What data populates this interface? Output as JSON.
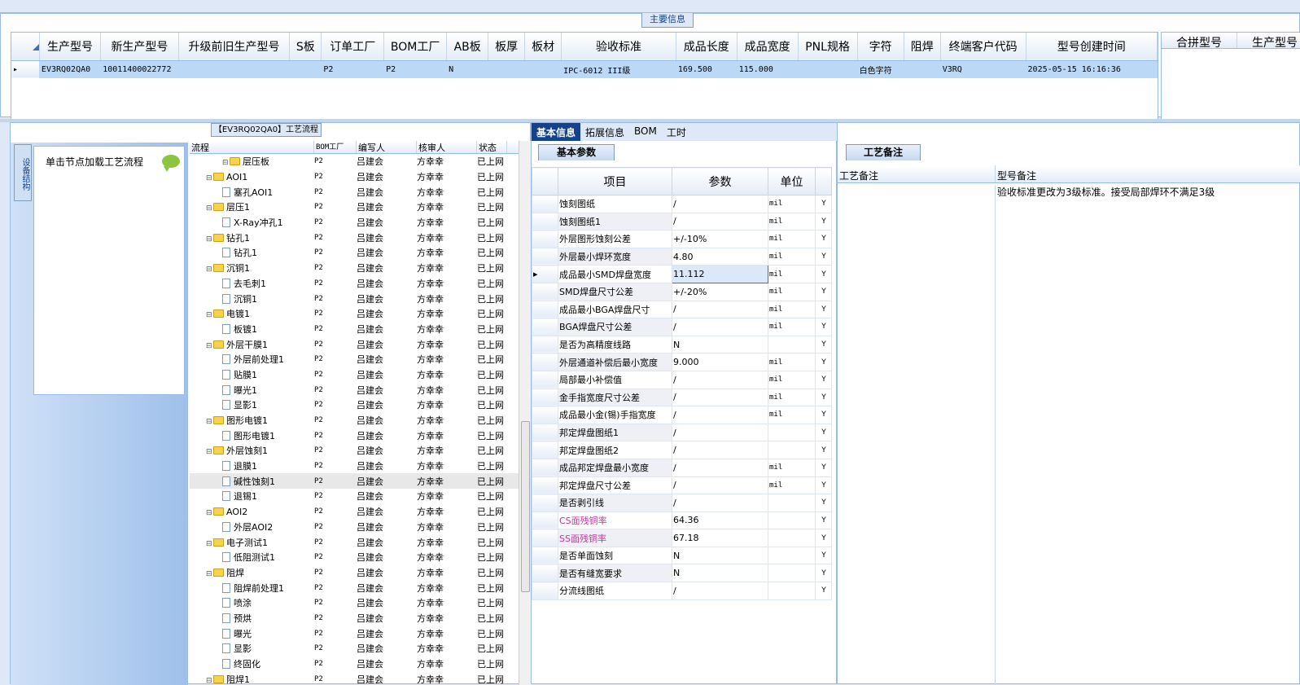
{
  "main_info": {
    "title": "主要信息",
    "columns": [
      "生产型号",
      "新生产型号",
      "升级前旧生产型号",
      "S板",
      "订单工厂",
      "BOM工厂",
      "AB板",
      "板厚",
      "板材",
      "验收标准",
      "成品长度",
      "成品宽度",
      "PNL规格",
      "字符",
      "阻焊",
      "终端客户代码",
      "型号创建时间"
    ],
    "row": [
      "EV3RQ02QA0",
      "10011400022772",
      "",
      "",
      "P2",
      "P2",
      "N",
      "",
      "",
      "IPC-6012 III级",
      "169.500",
      "115.000",
      "",
      "白色字符",
      "",
      "V3RQ",
      "2025-05-15 16:16:36"
    ],
    "right_columns": [
      "合拼型号",
      "生产型号"
    ]
  },
  "left": {
    "vertical_tab": "设备结构",
    "load_hint": "单击节点加载工艺流程",
    "tree_title": "【EV3RQ02QA0】工艺流程",
    "tree_columns": [
      "流程",
      "BOM工厂",
      "编写人",
      "核审人",
      "状态"
    ],
    "rows": [
      {
        "name": "层压板",
        "level": 1,
        "type": "folder",
        "bom": "P2",
        "writer": "吕建会",
        "reviewer": "方幸幸",
        "status": "已上网"
      },
      {
        "name": "AOI1",
        "level": 0,
        "type": "folder",
        "bom": "P2",
        "writer": "吕建会",
        "reviewer": "方幸幸",
        "status": "已上网"
      },
      {
        "name": "塞孔AOI1",
        "level": 1,
        "type": "doc",
        "bom": "P2",
        "writer": "吕建会",
        "reviewer": "方幸幸",
        "status": "已上网"
      },
      {
        "name": "层压1",
        "level": 0,
        "type": "folder",
        "bom": "P2",
        "writer": "吕建会",
        "reviewer": "方幸幸",
        "status": "已上网"
      },
      {
        "name": "X-Ray冲孔1",
        "level": 1,
        "type": "doc",
        "bom": "P2",
        "writer": "吕建会",
        "reviewer": "方幸幸",
        "status": "已上网"
      },
      {
        "name": "钻孔1",
        "level": 0,
        "type": "folder",
        "bom": "P2",
        "writer": "吕建会",
        "reviewer": "方幸幸",
        "status": "已上网"
      },
      {
        "name": "钻孔1",
        "level": 1,
        "type": "doc",
        "bom": "P2",
        "writer": "吕建会",
        "reviewer": "方幸幸",
        "status": "已上网"
      },
      {
        "name": "沉铜1",
        "level": 0,
        "type": "folder",
        "bom": "P2",
        "writer": "吕建会",
        "reviewer": "方幸幸",
        "status": "已上网"
      },
      {
        "name": "去毛刺1",
        "level": 1,
        "type": "doc",
        "bom": "P2",
        "writer": "吕建会",
        "reviewer": "方幸幸",
        "status": "已上网"
      },
      {
        "name": "沉铜1",
        "level": 1,
        "type": "doc",
        "bom": "P2",
        "writer": "吕建会",
        "reviewer": "方幸幸",
        "status": "已上网"
      },
      {
        "name": "电镀1",
        "level": 0,
        "type": "folder",
        "bom": "P2",
        "writer": "吕建会",
        "reviewer": "方幸幸",
        "status": "已上网"
      },
      {
        "name": "板镀1",
        "level": 1,
        "type": "doc",
        "bom": "P2",
        "writer": "吕建会",
        "reviewer": "方幸幸",
        "status": "已上网"
      },
      {
        "name": "外层干膜1",
        "level": 0,
        "type": "folder",
        "bom": "P2",
        "writer": "吕建会",
        "reviewer": "方幸幸",
        "status": "已上网"
      },
      {
        "name": "外层前处理1",
        "level": 1,
        "type": "doc",
        "bom": "P2",
        "writer": "吕建会",
        "reviewer": "方幸幸",
        "status": "已上网"
      },
      {
        "name": "贴膜1",
        "level": 1,
        "type": "doc",
        "bom": "P2",
        "writer": "吕建会",
        "reviewer": "方幸幸",
        "status": "已上网"
      },
      {
        "name": "曝光1",
        "level": 1,
        "type": "doc",
        "bom": "P2",
        "writer": "吕建会",
        "reviewer": "方幸幸",
        "status": "已上网"
      },
      {
        "name": "显影1",
        "level": 1,
        "type": "doc",
        "bom": "P2",
        "writer": "吕建会",
        "reviewer": "方幸幸",
        "status": "已上网"
      },
      {
        "name": "图形电镀1",
        "level": 0,
        "type": "folder",
        "bom": "P2",
        "writer": "吕建会",
        "reviewer": "方幸幸",
        "status": "已上网"
      },
      {
        "name": "图形电镀1",
        "level": 1,
        "type": "doc",
        "bom": "P2",
        "writer": "吕建会",
        "reviewer": "方幸幸",
        "status": "已上网"
      },
      {
        "name": "外层蚀刻1",
        "level": 0,
        "type": "folder",
        "bom": "P2",
        "writer": "吕建会",
        "reviewer": "方幸幸",
        "status": "已上网"
      },
      {
        "name": "退膜1",
        "level": 1,
        "type": "doc",
        "bom": "P2",
        "writer": "吕建会",
        "reviewer": "方幸幸",
        "status": "已上网"
      },
      {
        "name": "碱性蚀刻1",
        "level": 1,
        "type": "doc",
        "bom": "P2",
        "writer": "吕建会",
        "reviewer": "方幸幸",
        "status": "已上网",
        "selected": true
      },
      {
        "name": "退锡1",
        "level": 1,
        "type": "doc",
        "bom": "P2",
        "writer": "吕建会",
        "reviewer": "方幸幸",
        "status": "已上网"
      },
      {
        "name": "AOI2",
        "level": 0,
        "type": "folder",
        "bom": "P2",
        "writer": "吕建会",
        "reviewer": "方幸幸",
        "status": "已上网"
      },
      {
        "name": "外层AOI2",
        "level": 1,
        "type": "doc",
        "bom": "P2",
        "writer": "吕建会",
        "reviewer": "方幸幸",
        "status": "已上网"
      },
      {
        "name": "电子测试1",
        "level": 0,
        "type": "folder",
        "bom": "P2",
        "writer": "吕建会",
        "reviewer": "方幸幸",
        "status": "已上网"
      },
      {
        "name": "低阻测试1",
        "level": 1,
        "type": "doc",
        "bom": "P2",
        "writer": "吕建会",
        "reviewer": "方幸幸",
        "status": "已上网"
      },
      {
        "name": "阻焊",
        "level": 0,
        "type": "folder",
        "bom": "P2",
        "writer": "吕建会",
        "reviewer": "方幸幸",
        "status": "已上网"
      },
      {
        "name": "阻焊前处理1",
        "level": 1,
        "type": "doc",
        "bom": "P2",
        "writer": "吕建会",
        "reviewer": "方幸幸",
        "status": "已上网"
      },
      {
        "name": "喷涂",
        "level": 1,
        "type": "doc",
        "bom": "P2",
        "writer": "吕建会",
        "reviewer": "方幸幸",
        "status": "已上网"
      },
      {
        "name": "预烘",
        "level": 1,
        "type": "doc",
        "bom": "P2",
        "writer": "吕建会",
        "reviewer": "方幸幸",
        "status": "已上网"
      },
      {
        "name": "曝光",
        "level": 1,
        "type": "doc",
        "bom": "P2",
        "writer": "吕建会",
        "reviewer": "方幸幸",
        "status": "已上网"
      },
      {
        "name": "显影",
        "level": 1,
        "type": "doc",
        "bom": "P2",
        "writer": "吕建会",
        "reviewer": "方幸幸",
        "status": "已上网"
      },
      {
        "name": "终固化",
        "level": 1,
        "type": "doc",
        "bom": "P2",
        "writer": "吕建会",
        "reviewer": "方幸幸",
        "status": "已上网"
      },
      {
        "name": "阻焊1",
        "level": 0,
        "type": "folder",
        "bom": "P2",
        "writer": "吕建会",
        "reviewer": "方幸幸",
        "status": "已上网"
      }
    ]
  },
  "middle": {
    "tabs": [
      "基本信息",
      "拓展信息",
      "BOM",
      "工时"
    ],
    "subtab": "基本参数",
    "columns": [
      "项目",
      "参数",
      "单位"
    ],
    "params": [
      {
        "item": "蚀刻图纸",
        "value": "/",
        "unit": "mil",
        "flag": "Y"
      },
      {
        "item": "蚀刻图纸1",
        "value": "/",
        "unit": "mil",
        "flag": "Y"
      },
      {
        "item": "外层图形蚀刻公差",
        "value": "+/-10%",
        "unit": "mil",
        "flag": "Y"
      },
      {
        "item": "外层最小焊环宽度",
        "value": "4.80",
        "unit": "mil",
        "flag": "Y"
      },
      {
        "item": "成品最小SMD焊盘宽度",
        "value": "11.112",
        "unit": "mil",
        "flag": "Y",
        "current": true
      },
      {
        "item": "SMD焊盘尺寸公差",
        "value": "+/-20%",
        "unit": "mil",
        "flag": "Y"
      },
      {
        "item": "成品最小BGA焊盘尺寸",
        "value": "/",
        "unit": "mil",
        "flag": "Y"
      },
      {
        "item": "BGA焊盘尺寸公差",
        "value": "/",
        "unit": "mil",
        "flag": "Y"
      },
      {
        "item": "是否为高精度线路",
        "value": "N",
        "unit": "",
        "flag": "Y"
      },
      {
        "item": "外层通道补偿后最小宽度",
        "value": "9.000",
        "unit": "mil",
        "flag": "Y"
      },
      {
        "item": "局部最小补偿值",
        "value": "/",
        "unit": "mil",
        "flag": "Y"
      },
      {
        "item": "金手指宽度尺寸公差",
        "value": "/",
        "unit": "mil",
        "flag": "Y"
      },
      {
        "item": "成品最小金(锡)手指宽度",
        "value": "/",
        "unit": "mil",
        "flag": "Y"
      },
      {
        "item": "邦定焊盘图纸1",
        "value": "/",
        "unit": "",
        "flag": "Y"
      },
      {
        "item": "邦定焊盘图纸2",
        "value": "/",
        "unit": "",
        "flag": "Y"
      },
      {
        "item": "成品邦定焊盘最小宽度",
        "value": "/",
        "unit": "mil",
        "flag": "Y"
      },
      {
        "item": "邦定焊盘尺寸公差",
        "value": "/",
        "unit": "mil",
        "flag": "Y"
      },
      {
        "item": "是否剥引线",
        "value": "/",
        "unit": "",
        "flag": "Y"
      },
      {
        "item": "CS面残铜率",
        "value": "64.36",
        "unit": "",
        "flag": "Y",
        "pink": true
      },
      {
        "item": "SS面残铜率",
        "value": "67.18",
        "unit": "",
        "flag": "Y",
        "pink": true
      },
      {
        "item": "是否单面蚀刻",
        "value": "N",
        "unit": "",
        "flag": "Y"
      },
      {
        "item": "是否有缝宽要求",
        "value": "N",
        "unit": "",
        "flag": "Y"
      },
      {
        "item": "分流线图纸",
        "value": "/",
        "unit": "",
        "flag": "Y"
      }
    ]
  },
  "right": {
    "tab": "工艺备注",
    "columns": [
      "工艺备注",
      "型号备注"
    ],
    "model_note": "验收标准更改为3级标准。接受局部焊环不满足3级"
  },
  "colors": {
    "accent": "#15428b",
    "selection": "#bcd8f7",
    "pink_text": "#c2379c"
  }
}
